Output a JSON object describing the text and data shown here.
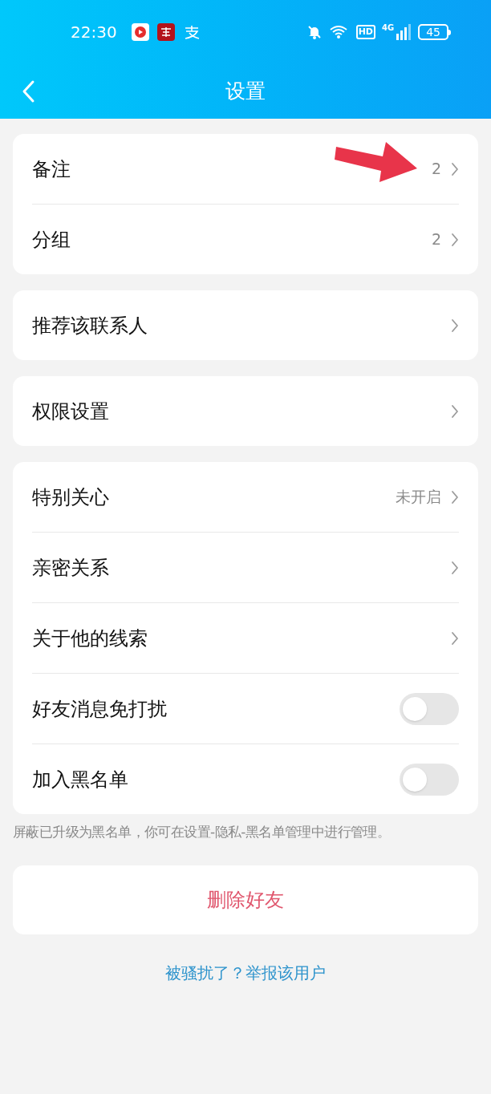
{
  "status_bar": {
    "time": "22:30",
    "hd": "HD",
    "network": "4G",
    "battery": "45"
  },
  "header": {
    "title": "设置"
  },
  "groups": [
    {
      "rows": [
        {
          "kind": "link",
          "label": "备注",
          "value": "2"
        },
        {
          "kind": "link",
          "label": "分组",
          "value": "2"
        }
      ]
    },
    {
      "rows": [
        {
          "kind": "link",
          "label": "推荐该联系人"
        }
      ]
    },
    {
      "rows": [
        {
          "kind": "link",
          "label": "权限设置"
        }
      ]
    },
    {
      "rows": [
        {
          "kind": "link",
          "label": "特别关心",
          "value": "未开启"
        },
        {
          "kind": "link",
          "label": "亲密关系"
        },
        {
          "kind": "link",
          "label": "关于他的线索"
        },
        {
          "kind": "toggle",
          "label": "好友消息免打扰",
          "on": false
        },
        {
          "kind": "toggle",
          "label": "加入黑名单",
          "on": false
        }
      ]
    }
  ],
  "note": "屏蔽已升级为黑名单，你可在设置-隐私-黑名单管理中进行管理。",
  "delete_button": "删除好友",
  "report_link": "被骚扰了？举报该用户"
}
